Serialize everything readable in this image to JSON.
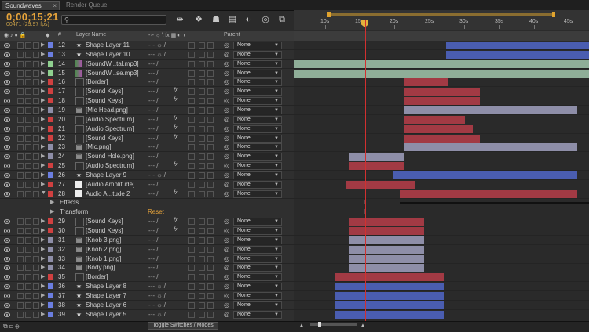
{
  "tabs": {
    "active": "Soundwaves",
    "inactive": "Render Queue",
    "close": "×"
  },
  "timecode": "0;00;15;21",
  "frames": "00471 (29.97 fps)",
  "search": {
    "placeholder": ""
  },
  "ruler_ticks": [
    "10s",
    "15s",
    "20s",
    "25s",
    "30s",
    "35s",
    "40s",
    "45s"
  ],
  "header": {
    "hash": "#",
    "layer_name": "Layer Name",
    "parent": "Parent"
  },
  "colors": {
    "blue": "#4a5db0",
    "red": "#a23a44",
    "gray": "#8e8ea8",
    "green": "#8fae98",
    "orange": "#e6a33a"
  },
  "layers": [
    {
      "num": "12",
      "name": "Shape Layer 11",
      "type": "star",
      "label": "#6b7ee0",
      "sw": "-·- ☼ /",
      "fx": "",
      "parent": "None",
      "bar": {
        "s": "blue",
        "a": 568,
        "b": 750
      }
    },
    {
      "num": "13",
      "name": "Shape Layer 10",
      "type": "star",
      "label": "#6b7ee0",
      "sw": "-·- ☼ /",
      "fx": "",
      "parent": "None",
      "bar": {
        "s": "blue",
        "a": 568,
        "b": 750
      }
    },
    {
      "num": "14",
      "name": "[SoundW...tal.mp3]",
      "type": "audio",
      "label": "#8fd08f",
      "sw": "-·-  /",
      "fx": "",
      "parent": "None",
      "bar": {
        "s": "green",
        "a": 375,
        "b": 750
      }
    },
    {
      "num": "15",
      "name": "[SoundW...se.mp3]",
      "type": "audio",
      "label": "#8fd08f",
      "sw": "-·-  /",
      "fx": "",
      "parent": "None",
      "bar": {
        "s": "green",
        "a": 375,
        "b": 750
      }
    },
    {
      "num": "16",
      "name": "[Border]",
      "type": "solid",
      "label": "#d04040",
      "sw": "-·-  /",
      "fx": "",
      "parent": "None",
      "bar": {
        "s": "red",
        "a": 515,
        "b": 570
      }
    },
    {
      "num": "17",
      "name": "[Sound Keys]",
      "type": "solid",
      "label": "#d04040",
      "sw": "-·-  /",
      "fx": "fx",
      "parent": "None",
      "bar": {
        "s": "red",
        "a": 515,
        "b": 611
      }
    },
    {
      "num": "18",
      "name": "[Sound Keys]",
      "type": "solid",
      "label": "#d04040",
      "sw": "-·-  /",
      "fx": "fx",
      "parent": "None",
      "bar": {
        "s": "red",
        "a": 515,
        "b": 611
      }
    },
    {
      "num": "19",
      "name": "[Mic Head.png]",
      "type": "file",
      "label": "#8e8ea8",
      "sw": "-·-  /",
      "fx": "",
      "parent": "None",
      "bar": {
        "s": "gray",
        "a": 515,
        "b": 735
      }
    },
    {
      "num": "20",
      "name": "[Audio Spectrum]",
      "type": "solid",
      "label": "#d04040",
      "sw": "-·-  /",
      "fx": "fx",
      "parent": "None",
      "bar": {
        "s": "red",
        "a": 515,
        "b": 592
      }
    },
    {
      "num": "21",
      "name": "[Audio Spectrum]",
      "type": "solid",
      "label": "#d04040",
      "sw": "-·-  /",
      "fx": "fx",
      "parent": "None",
      "bar": {
        "s": "red",
        "a": 515,
        "b": 602
      }
    },
    {
      "num": "22",
      "name": "[Sound Keys]",
      "type": "solid",
      "label": "#d04040",
      "sw": "-·-  /",
      "fx": "fx",
      "parent": "None",
      "bar": {
        "s": "red",
        "a": 515,
        "b": 611
      }
    },
    {
      "num": "23",
      "name": "[Mic.png]",
      "type": "file",
      "label": "#8e8ea8",
      "sw": "-·-  /",
      "fx": "",
      "parent": "None",
      "bar": {
        "s": "gray",
        "a": 515,
        "b": 735
      }
    },
    {
      "num": "24",
      "name": "[Sound Hole.png]",
      "type": "file",
      "label": "#8e8ea8",
      "sw": "-·-  /",
      "fx": "",
      "parent": "None",
      "bar": {
        "s": "gray",
        "a": 444,
        "b": 515
      }
    },
    {
      "num": "25",
      "name": "[Audio Spectrum]",
      "type": "solid",
      "label": "#d04040",
      "sw": "-·-  /",
      "fx": "fx",
      "parent": "None",
      "bar": {
        "s": "red",
        "a": 444,
        "b": 515
      }
    },
    {
      "num": "26",
      "name": "Shape Layer 9",
      "type": "star",
      "label": "#6b7ee0",
      "sw": "-·- ☼ /",
      "fx": "",
      "parent": "None",
      "bar": {
        "s": "blue",
        "a": 501,
        "b": 735
      }
    },
    {
      "num": "27",
      "name": "[Audio Amplitude]",
      "type": "white",
      "label": "#d04040",
      "sw": "-·-  /",
      "fx": "",
      "parent": "None",
      "bar": {
        "s": "red",
        "a": 440,
        "b": 529
      }
    },
    {
      "num": "28",
      "name": "Audio A...tude 2",
      "type": "white",
      "label": "#d04040",
      "sw": "-·-  /",
      "fx": "fx",
      "parent": "None",
      "bar": {
        "s": "red",
        "a": 509,
        "b": 735
      },
      "open": true
    }
  ],
  "sublayers": [
    {
      "name": "Effects"
    },
    {
      "name": "Transform",
      "reset": "Reset"
    }
  ],
  "layers2": [
    {
      "num": "29",
      "name": "[Sound Keys]",
      "type": "solid",
      "label": "#d04040",
      "sw": "-·-  /",
      "fx": "fx",
      "parent": "None",
      "bar": {
        "s": "red",
        "a": 444,
        "b": 540
      }
    },
    {
      "num": "30",
      "name": "[Sound Keys]",
      "type": "solid",
      "label": "#d04040",
      "sw": "-·-  /",
      "fx": "fx",
      "parent": "None",
      "bar": {
        "s": "red",
        "a": 444,
        "b": 540
      }
    },
    {
      "num": "31",
      "name": "[Knob 3.png]",
      "type": "file",
      "label": "#8e8ea8",
      "sw": "-·-  /",
      "fx": "",
      "parent": "None",
      "bar": {
        "s": "gray",
        "a": 444,
        "b": 540
      }
    },
    {
      "num": "32",
      "name": "[Knob 2.png]",
      "type": "file",
      "label": "#8e8ea8",
      "sw": "-·-  /",
      "fx": "",
      "parent": "None",
      "bar": {
        "s": "gray",
        "a": 444,
        "b": 540
      }
    },
    {
      "num": "33",
      "name": "[Knob 1.png]",
      "type": "file",
      "label": "#8e8ea8",
      "sw": "-·-  /",
      "fx": "",
      "parent": "None",
      "bar": {
        "s": "gray",
        "a": 444,
        "b": 540
      }
    },
    {
      "num": "34",
      "name": "[Body.png]",
      "type": "file",
      "label": "#8e8ea8",
      "sw": "-·-  /",
      "fx": "",
      "parent": "None",
      "bar": {
        "s": "gray",
        "a": 444,
        "b": 540
      }
    },
    {
      "num": "35",
      "name": "[Border]",
      "type": "solid",
      "label": "#d04040",
      "sw": "-·-  /",
      "fx": "",
      "parent": "None",
      "bar": {
        "s": "red",
        "a": 427,
        "b": 565
      }
    },
    {
      "num": "36",
      "name": "Shape Layer 8",
      "type": "star",
      "label": "#6b7ee0",
      "sw": "-·- ☼ /",
      "fx": "",
      "parent": "None",
      "bar": {
        "s": "blue",
        "a": 427,
        "b": 565
      }
    },
    {
      "num": "37",
      "name": "Shape Layer 7",
      "type": "star",
      "label": "#6b7ee0",
      "sw": "-·- ☼ /",
      "fx": "",
      "parent": "None",
      "bar": {
        "s": "blue",
        "a": 427,
        "b": 565
      }
    },
    {
      "num": "38",
      "name": "Shape Layer 6",
      "type": "star",
      "label": "#6b7ee0",
      "sw": "-·- ☼ /",
      "fx": "",
      "parent": "None",
      "bar": {
        "s": "blue",
        "a": 427,
        "b": 565
      }
    },
    {
      "num": "39",
      "name": "Shape Layer 5",
      "type": "star",
      "label": "#6b7ee0",
      "sw": "-·- ☼ /",
      "fx": "",
      "parent": "None",
      "bar": {
        "s": "blue",
        "a": 427,
        "b": 565
      }
    }
  ],
  "toggle": "Toggle Switches / Modes"
}
